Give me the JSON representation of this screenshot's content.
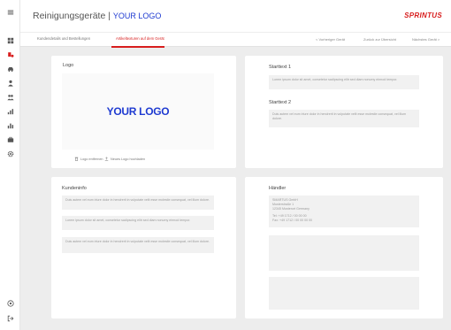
{
  "header": {
    "title": "Reinigungsgeräte | ",
    "logo_link": "YOUR LOGO",
    "brand": "SPRINTUS"
  },
  "tabs": [
    {
      "label": "Kundendetails und Bestellungen",
      "active": false
    },
    {
      "label": "Artikeltexturen auf dem Gerät",
      "active": true
    }
  ],
  "nav": {
    "prev": "< Vorheriger Gerät",
    "overview": "Zurück zur Übersicht",
    "next": "Nächstes Gerät >"
  },
  "logo_panel": {
    "title": "Logo",
    "logo_text": "YOUR LOGO",
    "remove_label": "Logo entfernen",
    "upload_label": "Neues Logo hochladen"
  },
  "start_panel": {
    "title1": "Starttext 1",
    "text1": "Lorem ipsum dolor sit amet, consetetur sadipscing elitr sed diam nonumy eirmod tempor.",
    "title2": "Starttext 2",
    "text2": "Duis autem vel eum iriure dolor in hendrerit in vulputate velit esse molestie consequat, vel illum dolore."
  },
  "kunden_panel": {
    "title": "Kundeninfo",
    "texts": [
      "Duis autem vel eum iriure dolor in hendrerit in vulputate velit esse molestie consequat, vel illum dolore.",
      "Lorem ipsum dolor sit amet, consetetur sadipscing elitr sed diam nonumy eirmod tempor.",
      "Duis autem vel eum iriure dolor in hendrerit in vulputate velit esse molestie consequat, vel illum dolore."
    ]
  },
  "haendler_panel": {
    "title": "Händler",
    "address_lines": [
      "SMARTUS GmbH",
      "Musterstraße 1",
      "12345 Musterort Germany"
    ],
    "contact_lines": [
      "Tel: +49 1712 / 00 00 00",
      "Fax: +49 1712 / 00 00 00 00"
    ]
  },
  "colors": {
    "accent": "#d81e1e",
    "logo_blue": "#1f3bd1"
  },
  "icons": {
    "menu": "menu-icon",
    "dashboard": "dashboard-icon",
    "devices": "devices-icon",
    "car": "car-icon",
    "user": "user-icon",
    "users": "users-icon",
    "chart": "chart-icon",
    "chart_alt": "chart-alt-icon",
    "case": "briefcase-icon",
    "settings": "gear-icon",
    "help": "help-icon",
    "logout": "logout-icon"
  }
}
